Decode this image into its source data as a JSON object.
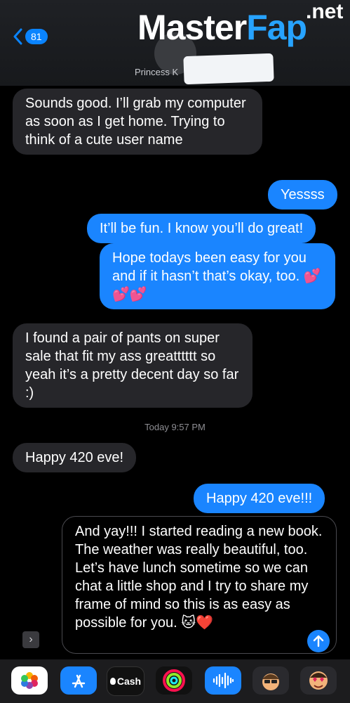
{
  "header": {
    "back_count": "81",
    "contact_name": "Princess K",
    "watermark_main_a": "Master",
    "watermark_main_b": "Fap",
    "watermark_suffix": ".net"
  },
  "messages": [
    {
      "direction": "in",
      "text": "Sounds good. I’ll grab my computer as soon as I get home. Trying to think of a cute user name"
    },
    {
      "direction": "out",
      "text": "Yessss"
    },
    {
      "direction": "out",
      "text": "It’ll be fun. I know you’ll do great!"
    },
    {
      "direction": "out",
      "text": "Hope todays been easy for you and if it hasn’t that’s okay, too. 💕💕💕"
    },
    {
      "direction": "in",
      "text": "I found a pair of pants on super sale that fit my ass greatttttt so yeah it’s a pretty decent day so far :)"
    },
    {
      "direction": "in",
      "text": "Happy 420 eve!"
    },
    {
      "direction": "out",
      "text": "Happy 420 eve!!!"
    }
  ],
  "timestamp": "Today 9:57 PM",
  "composer": {
    "text": "And yay!!! I started reading a new book. The weather was really beautiful, too. Let’s have lunch sometime so we can chat a little shop and I try to share my frame of mind so this is as easy as possible for you. 🐱❤️"
  },
  "app_strip": [
    {
      "name": "Photos",
      "icon": "photos-icon"
    },
    {
      "name": "App Store",
      "icon": "app-store-icon"
    },
    {
      "name": "Cash",
      "label": "Cash",
      "icon": "apple-cash-icon"
    },
    {
      "name": "Fitness",
      "icon": "activity-rings-icon"
    },
    {
      "name": "Audio",
      "icon": "audio-message-icon"
    },
    {
      "name": "Memoji",
      "icon": "memoji-icon"
    },
    {
      "name": "Memoji Stickers",
      "icon": "memoji-sticker-icon"
    }
  ],
  "colors": {
    "accent": "#1a85ff",
    "incoming": "#26262a",
    "background": "#000000"
  }
}
